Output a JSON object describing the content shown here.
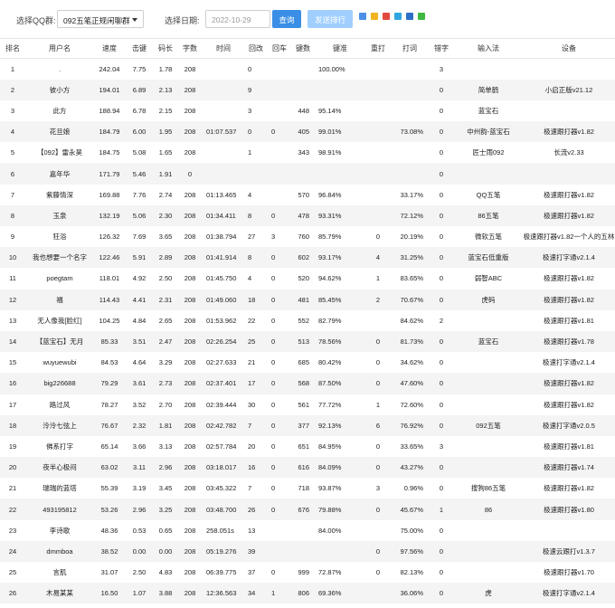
{
  "toolbar": {
    "qq_label": "选择QQ群:",
    "qq_group": "092五笔正规闲聊群",
    "date_label": "选择日期:",
    "date_value": "2022-10-29",
    "query_button": "查询",
    "send_button": "发送排行",
    "share_icons": [
      "qzone-icon",
      "star-icon",
      "weibo-icon",
      "qq-icon",
      "renren-icon",
      "wechat-icon"
    ],
    "colors": {
      "query": "#3a8ee6",
      "send": "#a0cfff"
    }
  },
  "table": {
    "columns": [
      "排名",
      "用户名",
      "速度",
      "击键",
      "码长",
      "字数",
      "时间",
      "回改",
      "回车",
      "键数",
      "键准",
      "重打",
      "打词",
      "错字",
      "输入法",
      "设备"
    ],
    "rows": [
      [
        "1",
        ".",
        "242.04",
        "7.75",
        "1.78",
        "208",
        "",
        "0",
        "",
        "",
        "100.00%",
        "",
        "",
        "3",
        "",
        ""
      ],
      [
        "2",
        "彼小方",
        "194.01",
        "6.89",
        "2.13",
        "208",
        "",
        "9",
        "",
        "",
        "",
        "",
        "",
        "0",
        "简单鹤",
        "小启正版v21.12"
      ],
      [
        "3",
        "此方",
        "188.94",
        "6.78",
        "2.15",
        "208",
        "",
        "3",
        "",
        "448",
        "95.14%",
        "",
        "",
        "0",
        "蓝宝石",
        ""
      ],
      [
        "4",
        "花旦娘",
        "184.79",
        "6.00",
        "1.95",
        "208",
        "01:07.537",
        "0",
        "0",
        "405",
        "99.01%",
        "",
        "73.08%",
        "0",
        "中州韵-蓝宝石",
        "极速跟打器v1.82"
      ],
      [
        "5",
        "【092】雷永昊",
        "184.75",
        "5.08",
        "1.65",
        "208",
        "",
        "1",
        "",
        "343",
        "98.91%",
        "",
        "",
        "0",
        "匠士雨092",
        "长流v2.33"
      ],
      [
        "6",
        "嘉年华",
        "171.79",
        "5.46",
        "1.91",
        "0",
        "",
        "",
        "",
        "",
        "",
        "",
        "",
        "0",
        "",
        ""
      ],
      [
        "7",
        "紫藤情深",
        "169.88",
        "7.76",
        "2.74",
        "208",
        "01:13.465",
        "4",
        "",
        "570",
        "96.84%",
        "",
        "33.17%",
        "0",
        "QQ五笔",
        "极速跟打器v1.82"
      ],
      [
        "8",
        "玉泉",
        "132.19",
        "5.06",
        "2.30",
        "208",
        "01:34.411",
        "8",
        "0",
        "478",
        "93.31%",
        "",
        "72.12%",
        "0",
        "86五笔",
        "极速跟打器v1.82"
      ],
      [
        "9",
        "狂浴",
        "126.32",
        "7.69",
        "3.65",
        "208",
        "01:38.794",
        "27",
        "3",
        "760",
        "85.79%",
        "0",
        "20.19%",
        "0",
        "微软五笔",
        "极速跟打器v1.82一个人的五林"
      ],
      [
        "10",
        "我也想要一个名字",
        "122.46",
        "5.91",
        "2.89",
        "208",
        "01:41.914",
        "8",
        "0",
        "602",
        "93.17%",
        "4",
        "31.25%",
        "0",
        "蓝宝石低重版",
        "极速打字通v2.1.4"
      ],
      [
        "11",
        "poegtam",
        "118.01",
        "4.92",
        "2.50",
        "208",
        "01:45.750",
        "4",
        "0",
        "520",
        "94.62%",
        "1",
        "83.65%",
        "0",
        "弱智ABC",
        "极速跟打器v1.82"
      ],
      [
        "12",
        "福",
        "114.43",
        "4.41",
        "2.31",
        "208",
        "01:49.060",
        "18",
        "0",
        "481",
        "85.45%",
        "2",
        "70.67%",
        "0",
        "虎码",
        "极速跟打器v1.82"
      ],
      [
        "13",
        "无人像我[脸红]",
        "104.25",
        "4.84",
        "2.65",
        "208",
        "01:53.962",
        "22",
        "0",
        "552",
        "82.79%",
        "",
        "84.62%",
        "2",
        "",
        "极速跟打器v1.81"
      ],
      [
        "14",
        "【蓝宝石】无月",
        "85.33",
        "3.51",
        "2.47",
        "208",
        "02:26.254",
        "25",
        "0",
        "513",
        "78.56%",
        "0",
        "81.73%",
        "0",
        "蓝宝石",
        "极速跟打器v1.78"
      ],
      [
        "15",
        "wuyuewubi",
        "84.53",
        "4.64",
        "3.29",
        "208",
        "02:27.633",
        "21",
        "0",
        "685",
        "80.42%",
        "0",
        "34.62%",
        "0",
        "",
        "极速打字通v2.1.4"
      ],
      [
        "16",
        "big226688",
        "79.29",
        "3.61",
        "2.73",
        "208",
        "02:37.401",
        "17",
        "0",
        "568",
        "87.50%",
        "0",
        "47.60%",
        "0",
        "",
        "极速跟打器v1.82"
      ],
      [
        "17",
        "路过风",
        "78.27",
        "3.52",
        "2.70",
        "208",
        "02:39.444",
        "30",
        "0",
        "561",
        "77.72%",
        "1",
        "72.60%",
        "0",
        "",
        "极速跟打器v1.82"
      ],
      [
        "18",
        "泠泠七弦上",
        "76.67",
        "2.32",
        "1.81",
        "208",
        "02:42.782",
        "7",
        "0",
        "377",
        "92.13%",
        "6",
        "76.92%",
        "0",
        "092五笔",
        "极速打字通v2.0.5"
      ],
      [
        "19",
        "佛系打字",
        "65.14",
        "3.66",
        "3.13",
        "208",
        "02:57.784",
        "20",
        "0",
        "651",
        "84.95%",
        "0",
        "33.65%",
        "3",
        "",
        "极速跟打器v1.81"
      ],
      [
        "20",
        "夜半心极闷",
        "63.02",
        "3.11",
        "2.96",
        "208",
        "03:18.017",
        "16",
        "0",
        "616",
        "84.09%",
        "0",
        "43.27%",
        "0",
        "",
        "极速跟打器v1.74"
      ],
      [
        "21",
        "瑞瑞的蓝塔",
        "55.39",
        "3.19",
        "3.45",
        "208",
        "03:45.322",
        "7",
        "0",
        "718",
        "93.87%",
        "3",
        "0.96%",
        "0",
        "搜狗86五笔",
        "极速跟打器v1.82"
      ],
      [
        "22",
        "493195812",
        "53.26",
        "2.96",
        "3.25",
        "208",
        "03:48.700",
        "26",
        "0",
        "676",
        "79.88%",
        "0",
        "45.67%",
        "1",
        "86",
        "极速跟打器v1.80"
      ],
      [
        "23",
        "李诗歌",
        "48.36",
        "0.53",
        "0.65",
        "208",
        "258.051s",
        "13",
        "",
        "",
        "84.00%",
        "",
        "75.00%",
        "0",
        "",
        ""
      ],
      [
        "24",
        "dmmboa",
        "38.52",
        "0.00",
        "0.00",
        "208",
        "05:19.276",
        "39",
        "",
        "",
        "",
        "0",
        "97.56%",
        "0",
        "",
        "极速云跟打v1.3.7"
      ],
      [
        "25",
        "言肌",
        "31.07",
        "2.50",
        "4.83",
        "208",
        "06:39.775",
        "37",
        "0",
        "999",
        "72.87%",
        "0",
        "82.13%",
        "0",
        "",
        "极速跟打器v1.70"
      ],
      [
        "26",
        "木易某某",
        "16.50",
        "1.07",
        "3.88",
        "208",
        "12:36.563",
        "34",
        "1",
        "806",
        "69.36%",
        "",
        "36.06%",
        "0",
        "虎",
        "极速打字通v2.1.4"
      ]
    ]
  }
}
